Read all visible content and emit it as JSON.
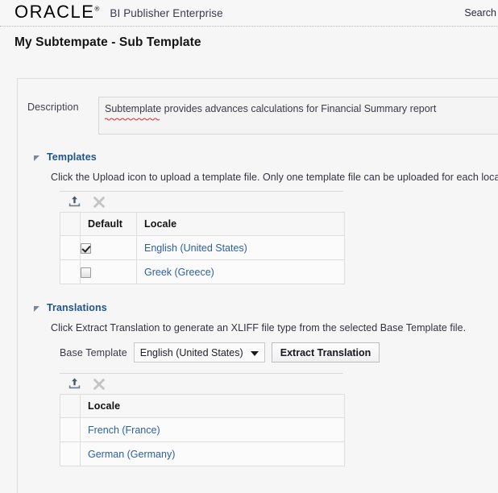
{
  "brand": {
    "logo_text": "ORACLE",
    "logo_reg": "®",
    "app_name": "BI Publisher Enterprise",
    "search_label": "Search"
  },
  "page": {
    "title": "My Subtempate - Sub Template"
  },
  "description": {
    "label": "Description",
    "value": "Subtemplate provides advances calculations for Financial Summary report",
    "placeholder": ""
  },
  "templates_section": {
    "title": "Templates",
    "hint": "Click the Upload icon to upload a template file. Only one template file can be uploaded for each locale.",
    "toolbar": {
      "upload_icon": "upload-icon",
      "delete_icon": "delete-icon"
    },
    "table": {
      "headers": [
        "",
        "Default",
        "Locale"
      ],
      "rows": [
        {
          "default_checked": true,
          "locale": "English (United States)"
        },
        {
          "default_checked": false,
          "locale": "Greek (Greece)"
        }
      ]
    }
  },
  "translations_section": {
    "title": "Translations",
    "hint": "Click Extract Translation to generate an XLIFF file type from the selected Base Template file.",
    "base_template_label": "Base Template",
    "base_template_value": "English (United States)",
    "extract_button": "Extract Translation",
    "toolbar": {
      "upload_icon": "upload-icon",
      "delete_icon": "delete-icon"
    },
    "table": {
      "headers": [
        "",
        "Locale"
      ],
      "rows": [
        {
          "locale": "French (France)"
        },
        {
          "locale": "German (Germany)"
        }
      ]
    }
  },
  "colors": {
    "link": "#2b5fa5",
    "section_title": "#20558a",
    "page_bg": "#f6f6f6",
    "panel_border": "#dcdcdc"
  }
}
